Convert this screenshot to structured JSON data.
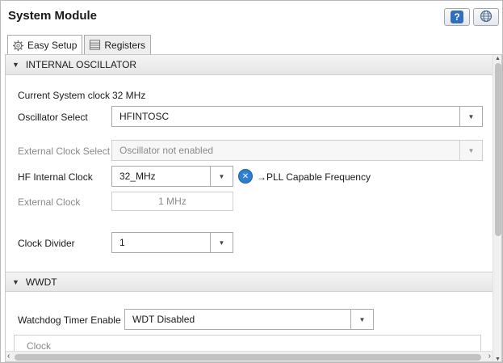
{
  "window": {
    "title": "System Module"
  },
  "toolbar": {
    "help_glyph": "?"
  },
  "tabs": [
    {
      "label": "Easy Setup",
      "icon": "gear-icon",
      "active": true
    },
    {
      "label": "Registers",
      "icon": "list-icon",
      "active": false
    }
  ],
  "internal_oscillator": {
    "header": "INTERNAL OSCILLATOR",
    "current_clock_label": "Current System clock",
    "current_clock_value": "32 MHz",
    "osc_select_label": "Oscillator Select",
    "osc_select_value": "HFINTOSC",
    "ext_clock_select_label": "External Clock Select",
    "ext_clock_select_value": "Oscillator not enabled",
    "hf_internal_clock_label": "HF Internal Clock",
    "hf_internal_clock_value": "32_MHz",
    "pll_note": "→PLL Capable Frequency",
    "external_clock_label": "External Clock",
    "external_clock_value": "1 MHz",
    "clock_divider_label": "Clock Divider",
    "clock_divider_value": "1"
  },
  "wwdt": {
    "header": "WWDT",
    "enable_label": "Watchdog Timer Enable",
    "enable_value": "WDT Disabled",
    "clock_group_label": "Clock"
  }
}
